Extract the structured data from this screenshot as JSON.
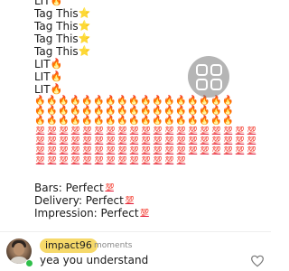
{
  "post_lines": [
    {
      "text": "LIT",
      "emoji": "🔥",
      "kind": "fire"
    },
    {
      "text": "Tag This",
      "emoji": "⭐",
      "kind": "star"
    },
    {
      "text": "Tag This",
      "emoji": "⭐",
      "kind": "star"
    },
    {
      "text": "Tag This",
      "emoji": "⭐",
      "kind": "star"
    },
    {
      "text": "Tag This",
      "emoji": "⭐",
      "kind": "star"
    },
    {
      "text": "LIT",
      "emoji": "🔥",
      "kind": "fire"
    },
    {
      "text": "LIT",
      "emoji": "🔥",
      "kind": "fire"
    },
    {
      "text": "LIT",
      "emoji": "🔥",
      "kind": "fire"
    }
  ],
  "emoji_grid": [
    {
      "emoji": "🔥",
      "kind": "fire",
      "count": 17
    },
    {
      "emoji": "🔥",
      "kind": "fire",
      "count": 17
    },
    {
      "emoji": "🔥",
      "kind": "fire",
      "count": 17
    },
    {
      "emoji": "💯",
      "kind": "hundred",
      "count": 19
    },
    {
      "emoji": "💯",
      "kind": "hundred",
      "count": 19
    },
    {
      "emoji": "💯",
      "kind": "hundred",
      "count": 19
    },
    {
      "emoji": "💯",
      "kind": "hundred",
      "count": 13
    }
  ],
  "ratings": [
    {
      "text": "Bars: Perfect",
      "emoji": "💯"
    },
    {
      "text": "Delivery: Perfect",
      "emoji": "💯"
    },
    {
      "text": "Impression: Perfect",
      "emoji": "💯"
    }
  ],
  "comment": {
    "username": "impact96",
    "timestamp": "moments",
    "text": "yea you understand",
    "online": true
  },
  "icons": {
    "floating_button": "grid-overlay-icon",
    "like": "heart-outline-icon"
  },
  "colors": {
    "username_pill": "#f6d96a",
    "online_dot": "#2fbf4a",
    "floating_button": "rgba(120,120,120,0.55)"
  }
}
